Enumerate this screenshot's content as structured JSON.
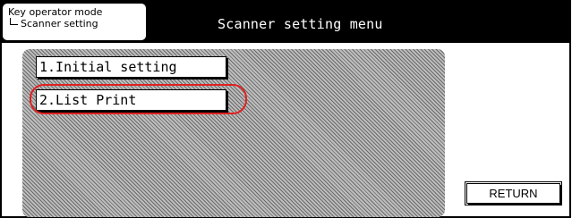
{
  "header": {
    "mode_line1": "Key operator mode",
    "mode_line2": "Scanner setting",
    "title": "Scanner setting menu"
  },
  "menu": {
    "items": [
      {
        "label": "1.Initial setting"
      },
      {
        "label": "2.List Print",
        "highlighted": true
      }
    ]
  },
  "footer": {
    "return_label": "RETURN"
  },
  "colors": {
    "highlight": "#e02020",
    "topbar": "#000000"
  }
}
